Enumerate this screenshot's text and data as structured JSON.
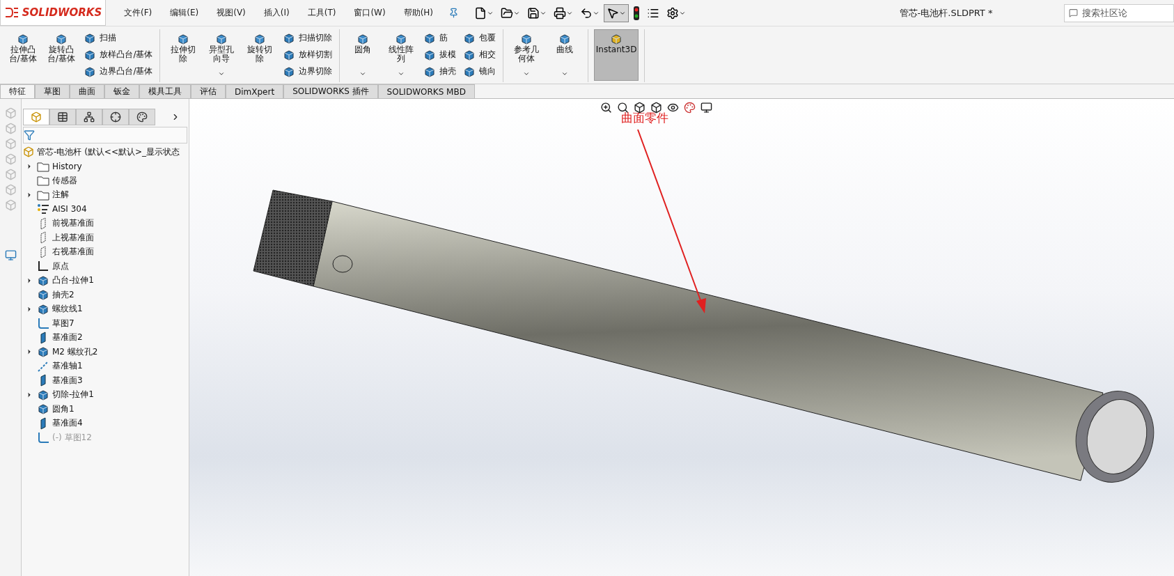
{
  "app": {
    "logo": "SOLIDWORKS",
    "menu": [
      "文件(F)",
      "编辑(E)",
      "视图(V)",
      "插入(I)",
      "工具(T)",
      "窗口(W)",
      "帮助(H)"
    ],
    "document_title": "管芯-电池杆.SLDPRT *",
    "search": {
      "placeholder": "搜索社区论"
    }
  },
  "quick_tools": [
    {
      "dropdown": true,
      "selected": false
    },
    {
      "dropdown": true,
      "selected": false
    },
    {
      "dropdown": true,
      "selected": false
    },
    {
      "dropdown": true,
      "selected": false
    },
    {
      "dropdown": true,
      "selected": false
    },
    {
      "dropdown": true,
      "selected": true
    },
    {
      "dropdown": false,
      "selected": false
    },
    {
      "dropdown": false,
      "selected": false
    },
    {
      "dropdown": true,
      "selected": false
    }
  ],
  "ribbon": [
    {
      "items": [
        {
          "kind": "large",
          "label": "拉伸凸台/基体",
          "dropdown": false,
          "selected": false
        },
        {
          "kind": "large",
          "label": "旋转凸台/基体",
          "dropdown": false,
          "selected": false
        },
        {
          "kind": "column",
          "small": [
            "扫描",
            "放样凸台/基体",
            "边界凸台/基体"
          ]
        }
      ]
    },
    {
      "items": [
        {
          "kind": "large",
          "label": "拉伸切除",
          "dropdown": false,
          "selected": false
        },
        {
          "kind": "large",
          "label": "异型孔向导",
          "dropdown": true,
          "selected": false
        },
        {
          "kind": "large",
          "label": "旋转切除",
          "dropdown": false,
          "selected": false
        },
        {
          "kind": "column",
          "small": [
            "扫描切除",
            "放样切割",
            "边界切除"
          ]
        }
      ]
    },
    {
      "items": [
        {
          "kind": "large",
          "label": "圆角",
          "dropdown": true,
          "selected": false
        },
        {
          "kind": "large",
          "label": "线性阵列",
          "dropdown": true,
          "selected": false
        },
        {
          "kind": "column",
          "small": [
            "筋",
            "拔模",
            "抽壳"
          ]
        },
        {
          "kind": "column",
          "small": [
            "包覆",
            "相交",
            "镜向"
          ]
        }
      ]
    },
    {
      "items": [
        {
          "kind": "large",
          "label": "参考几何体",
          "dropdown": true,
          "selected": false
        },
        {
          "kind": "large",
          "label": "曲线",
          "dropdown": true,
          "selected": false
        }
      ]
    },
    {
      "items": [
        {
          "kind": "toggle",
          "label": "Instant3D",
          "dropdown": false,
          "selected": true
        }
      ]
    }
  ],
  "tabs": [
    {
      "label": "特征",
      "selected": true
    },
    {
      "label": "草图",
      "selected": false
    },
    {
      "label": "曲面",
      "selected": false
    },
    {
      "label": "钣金",
      "selected": false
    },
    {
      "label": "模具工具",
      "selected": false
    },
    {
      "label": "评估",
      "selected": false
    },
    {
      "label": "DimXpert",
      "selected": false
    },
    {
      "label": "SOLIDWORKS 插件",
      "selected": false
    },
    {
      "label": "SOLIDWORKS MBD",
      "selected": false
    }
  ],
  "panel_tabs": [
    {
      "selected": true
    },
    {
      "selected": false
    },
    {
      "selected": false
    },
    {
      "selected": false
    },
    {
      "selected": false
    }
  ],
  "tree": {
    "root": "管芯-电池杆  (默认<<默认>_显示状态",
    "items": [
      {
        "label": "History",
        "expandable": true,
        "disabled": false
      },
      {
        "label": "传感器",
        "expandable": false,
        "disabled": false
      },
      {
        "label": "注解",
        "expandable": true,
        "disabled": false
      },
      {
        "label": "AISI 304",
        "expandable": false,
        "disabled": false
      },
      {
        "label": "前视基准面",
        "expandable": false,
        "disabled": false
      },
      {
        "label": "上视基准面",
        "expandable": false,
        "disabled": false
      },
      {
        "label": "右视基准面",
        "expandable": false,
        "disabled": false
      },
      {
        "label": "原点",
        "expandable": false,
        "disabled": false
      },
      {
        "label": "凸台-拉伸1",
        "expandable": true,
        "disabled": false
      },
      {
        "label": "抽壳2",
        "expandable": false,
        "disabled": false
      },
      {
        "label": "螺纹线1",
        "expandable": true,
        "disabled": false
      },
      {
        "label": "草图7",
        "expandable": false,
        "disabled": false
      },
      {
        "label": "基准面2",
        "expandable": false,
        "disabled": false
      },
      {
        "label": "M2 螺纹孔2",
        "expandable": true,
        "disabled": false
      },
      {
        "label": "基准轴1",
        "expandable": false,
        "disabled": false
      },
      {
        "label": "基准面3",
        "expandable": false,
        "disabled": false
      },
      {
        "label": "切除-拉伸1",
        "expandable": true,
        "disabled": false
      },
      {
        "label": "圆角1",
        "expandable": false,
        "disabled": false
      },
      {
        "label": "基准面4",
        "expandable": false,
        "disabled": false
      },
      {
        "label": "(-) 草图12",
        "expandable": false,
        "disabled": true
      }
    ]
  },
  "viewport": {
    "annotation": "曲面零件"
  }
}
